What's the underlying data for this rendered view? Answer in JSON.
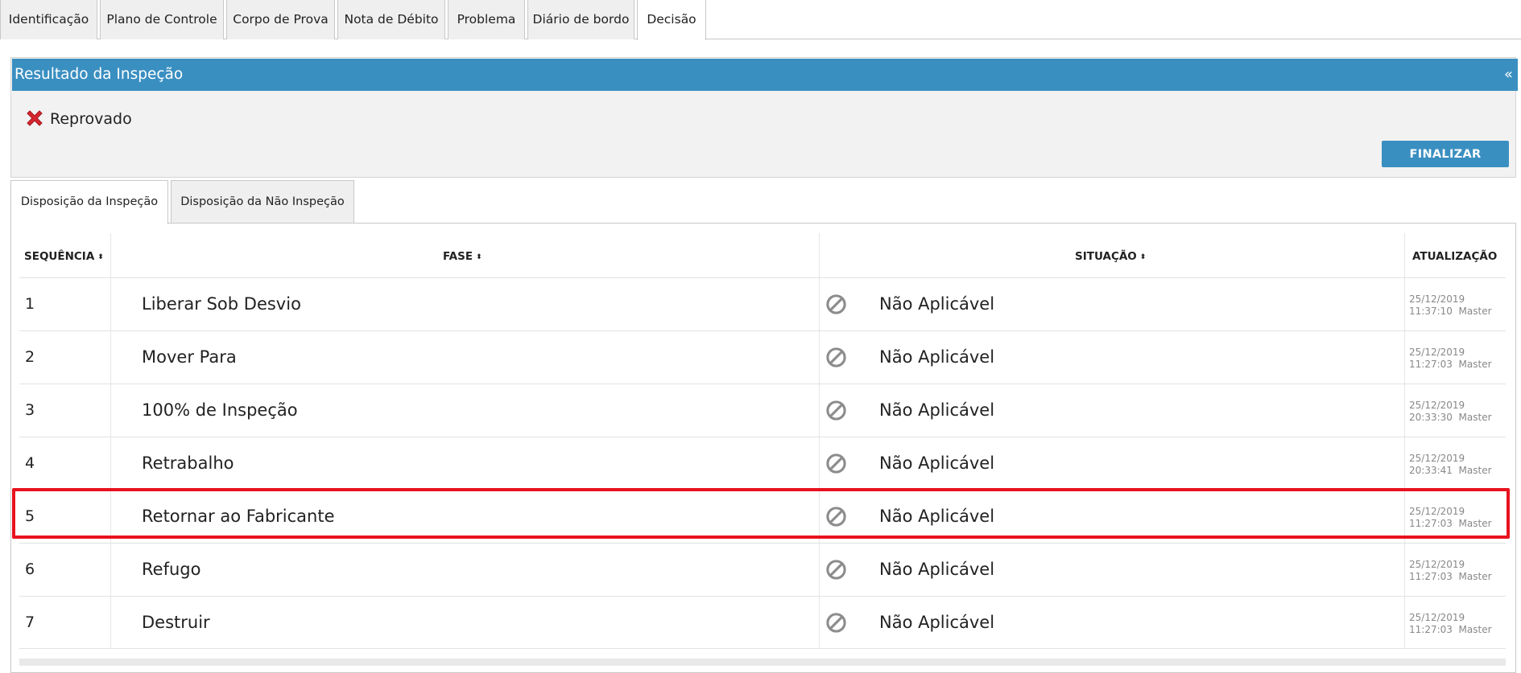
{
  "top_tabs": [
    {
      "label": "Identificação"
    },
    {
      "label": "Plano de Controle"
    },
    {
      "label": "Corpo de Prova"
    },
    {
      "label": "Nota de Débito"
    },
    {
      "label": "Problema"
    },
    {
      "label": "Diário de bordo"
    },
    {
      "label": "Decisão",
      "active": true
    }
  ],
  "panel": {
    "title": "Resultado da Inspeção",
    "collapse": "«",
    "result": "Reprovado",
    "finalize_label": "FINALIZAR"
  },
  "sub_tabs": [
    {
      "label": "Disposição da Inspeção",
      "active": true
    },
    {
      "label": "Disposição da Não Inspeção"
    }
  ],
  "table": {
    "headers": {
      "seq": "SEQUÊNCIA",
      "fase": "FASE",
      "situacao": "SITUAÇÃO",
      "atualizacao": "ATUALIZAÇÃO"
    },
    "sort_glyph": "⬍",
    "rows": [
      {
        "seq": "1",
        "fase": "Liberar Sob Desvio",
        "situacao": "Não Aplicável",
        "date": "25/12/2019",
        "time": "11:37:10",
        "user": "Master"
      },
      {
        "seq": "2",
        "fase": "Mover Para",
        "situacao": "Não Aplicável",
        "date": "25/12/2019",
        "time": "11:27:03",
        "user": "Master"
      },
      {
        "seq": "3",
        "fase": "100% de Inspeção",
        "situacao": "Não Aplicável",
        "date": "25/12/2019",
        "time": "20:33:30",
        "user": "Master"
      },
      {
        "seq": "4",
        "fase": "Retrabalho",
        "situacao": "Não Aplicável",
        "date": "25/12/2019",
        "time": "20:33:41",
        "user": "Master"
      },
      {
        "seq": "5",
        "fase": "Retornar ao Fabricante",
        "situacao": "Não Aplicável",
        "date": "25/12/2019",
        "time": "11:27:03",
        "user": "Master"
      },
      {
        "seq": "6",
        "fase": "Refugo",
        "situacao": "Não Aplicável",
        "date": "25/12/2019",
        "time": "11:27:03",
        "user": "Master"
      },
      {
        "seq": "7",
        "fase": "Destruir",
        "situacao": "Não Aplicável",
        "date": "25/12/2019",
        "time": "11:27:03",
        "user": "Master"
      }
    ]
  },
  "colors": {
    "accent": "#3a8fc1",
    "highlight": "#e8121e",
    "reject": "#d8262f",
    "block_icon": "#8c8c8c"
  },
  "icons": {
    "result": "x-icon",
    "status": "block-icon",
    "collapse": "double-chevron-left-icon",
    "sort": "sort-icon"
  }
}
